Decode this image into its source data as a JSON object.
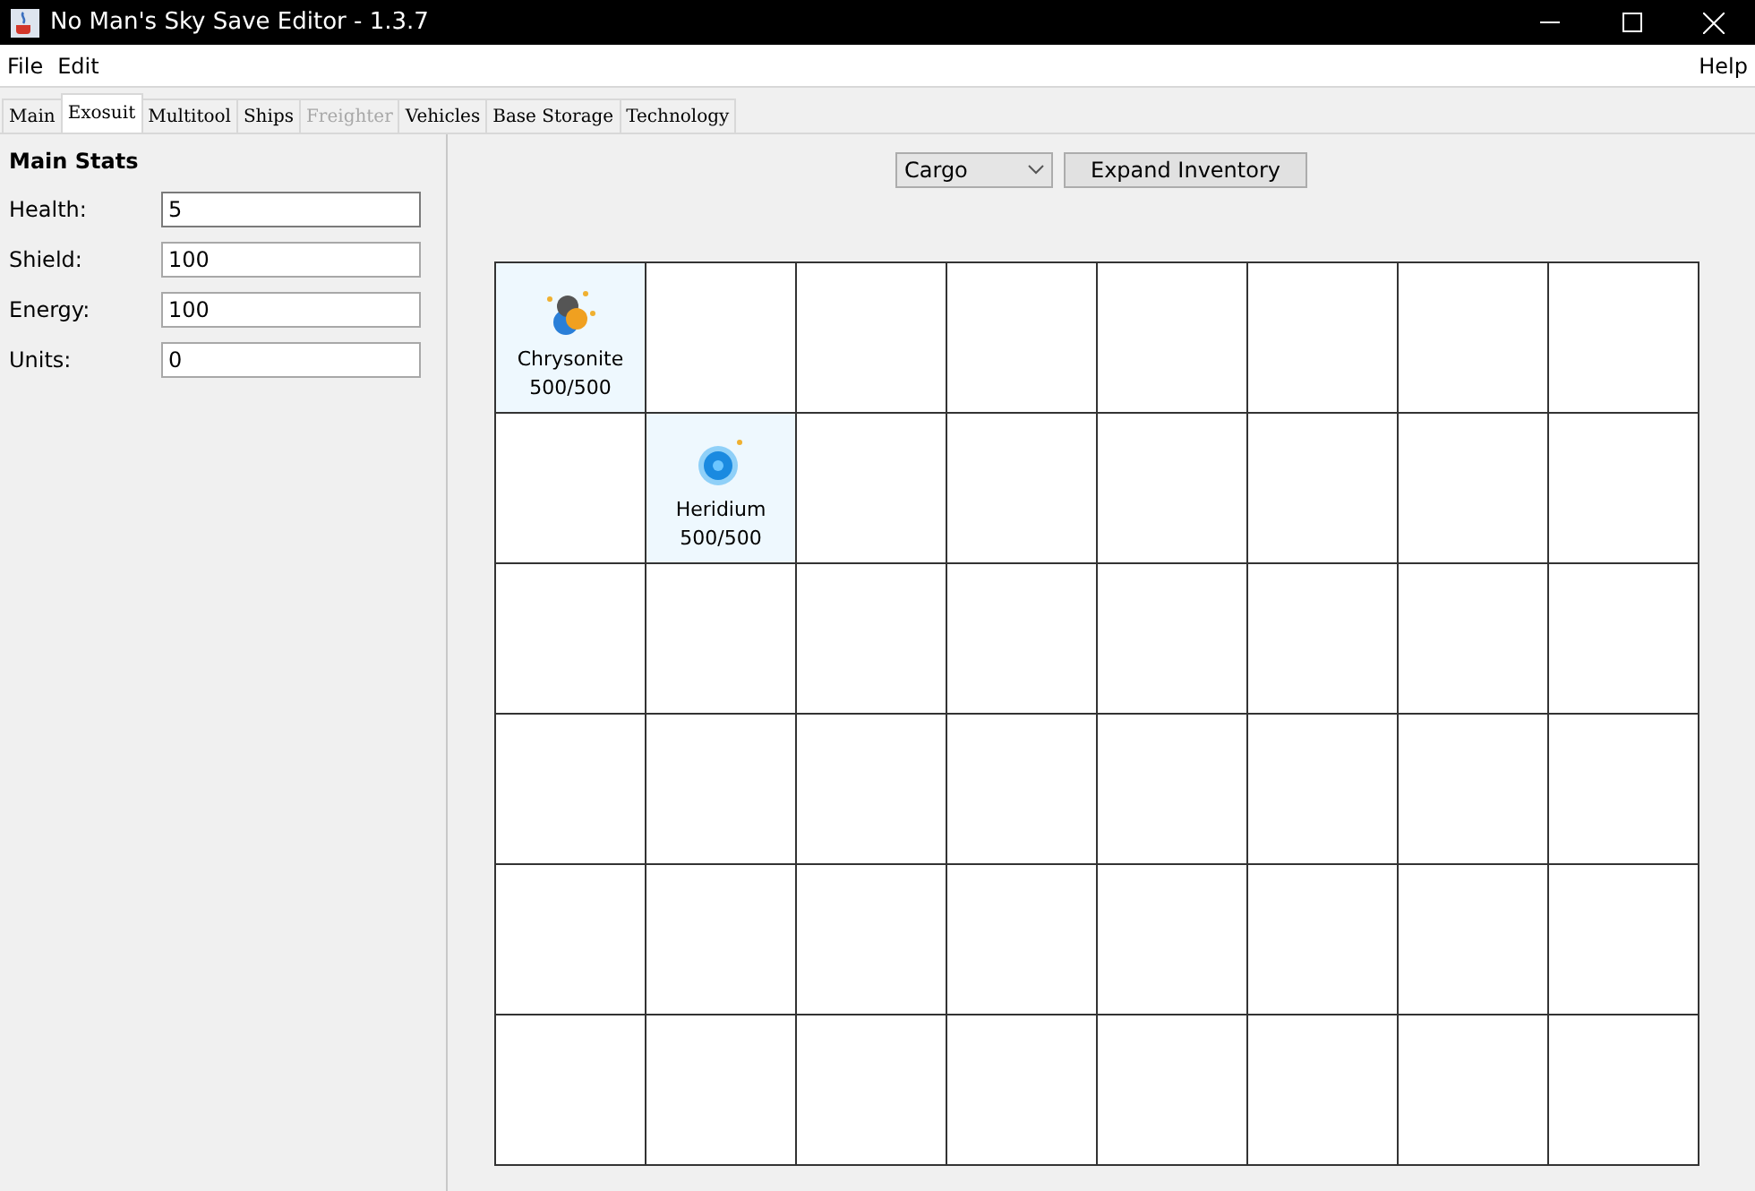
{
  "window": {
    "title": "No Man's Sky Save Editor - 1.3.7"
  },
  "menu": {
    "left": [
      "File",
      "Edit"
    ],
    "right": [
      "Help"
    ]
  },
  "tabs": [
    {
      "label": "Main",
      "selected": false,
      "disabled": false
    },
    {
      "label": "Exosuit",
      "selected": true,
      "disabled": false
    },
    {
      "label": "Multitool",
      "selected": false,
      "disabled": false
    },
    {
      "label": "Ships",
      "selected": false,
      "disabled": false
    },
    {
      "label": "Freighter",
      "selected": false,
      "disabled": true
    },
    {
      "label": "Vehicles",
      "selected": false,
      "disabled": false
    },
    {
      "label": "Base Storage",
      "selected": false,
      "disabled": false
    },
    {
      "label": "Technology",
      "selected": false,
      "disabled": false
    }
  ],
  "stats": {
    "title": "Main Stats",
    "fields": [
      {
        "label": "Health:",
        "value": "5",
        "focused": true
      },
      {
        "label": "Shield:",
        "value": "100",
        "focused": false
      },
      {
        "label": "Energy:",
        "value": "100",
        "focused": false
      },
      {
        "label": "Units:",
        "value": "0",
        "focused": false
      }
    ]
  },
  "inventory": {
    "dropdown": "Cargo",
    "button": "Expand Inventory",
    "rows": [
      [
        {
          "kind": "chrysonite",
          "name": "Chrysonite",
          "amount": "500/500"
        },
        {
          "kind": "empty"
        },
        {
          "kind": "empty"
        },
        {
          "kind": "empty"
        },
        {
          "kind": "empty"
        },
        {
          "kind": "empty"
        },
        {
          "kind": "empty"
        },
        {
          "kind": "empty"
        }
      ],
      [
        {
          "kind": "empty"
        },
        {
          "kind": "heridium",
          "name": "Heridium",
          "amount": "500/500"
        },
        {
          "kind": "empty"
        },
        {
          "kind": "empty"
        },
        {
          "kind": "empty"
        },
        {
          "kind": "empty"
        },
        {
          "kind": "empty"
        },
        {
          "kind": "empty"
        }
      ],
      [
        {
          "kind": "empty"
        },
        {
          "kind": "empty"
        },
        {
          "kind": "empty"
        },
        {
          "kind": "empty"
        },
        {
          "kind": "empty"
        },
        {
          "kind": "empty"
        },
        {
          "kind": "empty"
        },
        {
          "kind": "empty"
        }
      ],
      [
        {
          "kind": "empty"
        },
        {
          "kind": "empty"
        },
        {
          "kind": "empty"
        },
        {
          "kind": "empty"
        },
        {
          "kind": "empty"
        },
        {
          "kind": "empty"
        },
        {
          "kind": "empty"
        },
        {
          "kind": "empty"
        }
      ],
      [
        {
          "kind": "empty"
        },
        {
          "kind": "empty"
        },
        {
          "kind": "empty"
        },
        {
          "kind": "empty"
        },
        {
          "kind": "empty"
        },
        {
          "kind": "empty"
        },
        {
          "kind": "empty"
        },
        {
          "kind": "empty"
        }
      ],
      [
        {
          "kind": "empty"
        },
        {
          "kind": "empty"
        },
        {
          "kind": "empty"
        },
        {
          "kind": "empty"
        },
        {
          "kind": "empty"
        },
        {
          "kind": "empty"
        },
        {
          "kind": "empty"
        },
        {
          "kind": "empty"
        }
      ]
    ]
  }
}
